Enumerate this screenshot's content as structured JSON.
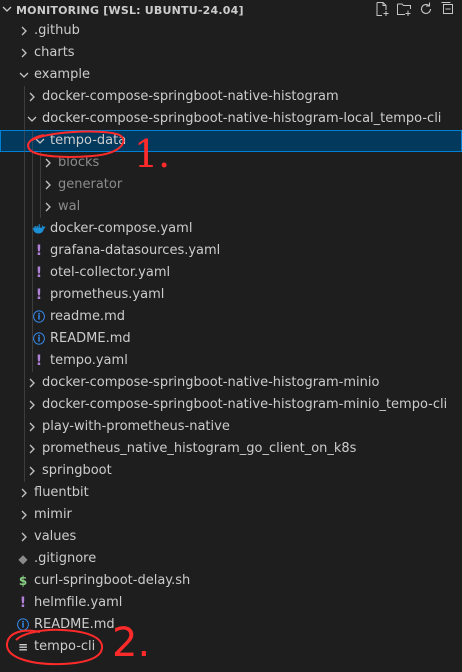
{
  "explorer": {
    "title": "MONITORING [WSL: UBUNTU-24.04]",
    "actions": [
      "new-file-icon",
      "new-folder-icon",
      "refresh-icon",
      "collapse-all-icon"
    ]
  },
  "tree": [
    {
      "label": ".github",
      "kind": "folder",
      "expanded": false,
      "depth": 1
    },
    {
      "label": "charts",
      "kind": "folder",
      "expanded": false,
      "depth": 1
    },
    {
      "label": "example",
      "kind": "folder",
      "expanded": true,
      "depth": 1
    },
    {
      "label": "docker-compose-springboot-native-histogram",
      "kind": "folder",
      "expanded": false,
      "depth": 2
    },
    {
      "label": "docker-compose-springboot-native-histogram-local_tempo-cli",
      "kind": "folder",
      "expanded": true,
      "depth": 2
    },
    {
      "label": "tempo-data",
      "kind": "folder",
      "expanded": true,
      "depth": 3,
      "selected": true
    },
    {
      "label": "blocks",
      "kind": "folder",
      "expanded": false,
      "depth": 4,
      "dim": true
    },
    {
      "label": "generator",
      "kind": "folder",
      "expanded": false,
      "depth": 4,
      "dim": true
    },
    {
      "label": "wal",
      "kind": "folder",
      "expanded": false,
      "depth": 4,
      "dim": true
    },
    {
      "label": "docker-compose.yaml",
      "kind": "file",
      "icon": "docker-icon",
      "depth": 3
    },
    {
      "label": "grafana-datasources.yaml",
      "kind": "file",
      "icon": "yaml-icon",
      "depth": 3
    },
    {
      "label": "otel-collector.yaml",
      "kind": "file",
      "icon": "yaml-icon",
      "depth": 3
    },
    {
      "label": "prometheus.yaml",
      "kind": "file",
      "icon": "yaml-icon",
      "depth": 3
    },
    {
      "label": "readme.md",
      "kind": "file",
      "icon": "info-icon",
      "depth": 3
    },
    {
      "label": "README.md",
      "kind": "file",
      "icon": "info-icon",
      "depth": 3
    },
    {
      "label": "tempo.yaml",
      "kind": "file",
      "icon": "yaml-icon",
      "depth": 3
    },
    {
      "label": "docker-compose-springboot-native-histogram-minio",
      "kind": "folder",
      "expanded": false,
      "depth": 2
    },
    {
      "label": "docker-compose-springboot-native-histogram-minio_tempo-cli",
      "kind": "folder",
      "expanded": false,
      "depth": 2
    },
    {
      "label": "play-with-prometheus-native",
      "kind": "folder",
      "expanded": false,
      "depth": 2
    },
    {
      "label": "prometheus_native_histogram_go_client_on_k8s",
      "kind": "folder",
      "expanded": false,
      "depth": 2
    },
    {
      "label": "springboot",
      "kind": "folder",
      "expanded": false,
      "depth": 2
    },
    {
      "label": "fluentbit",
      "kind": "folder",
      "expanded": false,
      "depth": 1
    },
    {
      "label": "mimir",
      "kind": "folder",
      "expanded": false,
      "depth": 1
    },
    {
      "label": "values",
      "kind": "folder",
      "expanded": false,
      "depth": 1
    },
    {
      "label": ".gitignore",
      "kind": "file",
      "icon": "gitignore-icon",
      "depth": 1
    },
    {
      "label": "curl-springboot-delay.sh",
      "kind": "file",
      "icon": "shell-icon",
      "depth": 1
    },
    {
      "label": "helmfile.yaml",
      "kind": "file",
      "icon": "yaml-icon",
      "depth": 1
    },
    {
      "label": "README.md",
      "kind": "file",
      "icon": "info-icon",
      "depth": 1
    },
    {
      "label": "tempo-cli",
      "kind": "file",
      "icon": "lines-icon",
      "depth": 1
    }
  ],
  "annotations": [
    {
      "text": "1.",
      "color": "#ff2a2a"
    },
    {
      "text": "2.",
      "color": "#ff2a2a"
    }
  ],
  "colors": {
    "background": "#1e1e1e",
    "selection": "#04395e",
    "selection_border": "#007fd4",
    "annotation": "#ff2a2a"
  }
}
